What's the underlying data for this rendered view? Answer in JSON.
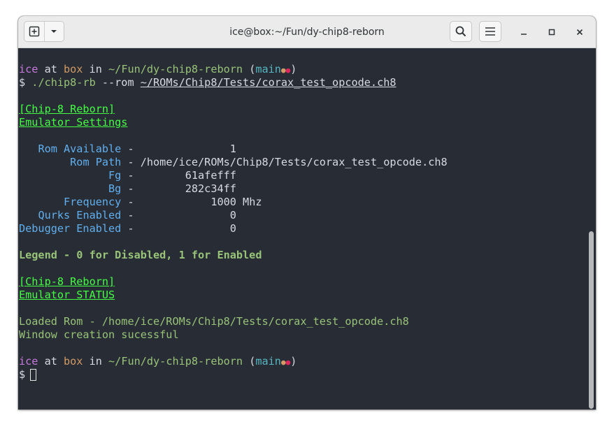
{
  "window": {
    "title": "ice@box:~/Fun/dy-chip8-reborn",
    "minimize_glyph": "–",
    "maximize_glyph": "□",
    "close_glyph": "×",
    "icons": [
      "new-tab-icon",
      "dropdown-icon",
      "search-icon",
      "hamburger-menu-icon",
      "minimize-icon",
      "maximize-icon",
      "close-icon"
    ]
  },
  "prompt": {
    "user": "ice",
    "at": " at ",
    "host": "box",
    "in": " in ",
    "path": "~/Fun/dy-chip8-reborn",
    "open_paren": " (",
    "branch": "main",
    "dot1": "●",
    "dot2": "●",
    "close_paren": ")",
    "dollar": "$ "
  },
  "command": {
    "program": "./chip8-rb",
    "flag": " --rom ",
    "arg": "~/ROMs/Chip8/Tests/corax_test_opcode.ch8"
  },
  "output": {
    "header1": "[Chip-8 Reborn]",
    "header1_sub": "Emulator Settings",
    "settings": [
      {
        "pad": "   ",
        "label": "Rom Available",
        "sep": " - ",
        "value": "              1"
      },
      {
        "pad": "        ",
        "label": "Rom Path",
        "sep": " - ",
        "value": "/home/ice/ROMs/Chip8/Tests/corax_test_opcode.ch8"
      },
      {
        "pad": "              ",
        "label": "Fg",
        "sep": " - ",
        "value": "       61afefff"
      },
      {
        "pad": "              ",
        "label": "Bg",
        "sep": " - ",
        "value": "       282c34ff"
      },
      {
        "pad": "       ",
        "label": "Frequency",
        "sep": " - ",
        "value": "           1000 Mhz"
      },
      {
        "pad": "   ",
        "label": "Qurks Enabled",
        "sep": " - ",
        "value": "              0"
      },
      {
        "pad": "",
        "label": "Debugger Enabled",
        "sep": " - ",
        "value": "              0"
      }
    ],
    "legend": "Legend - 0 for Disabled, 1 for Enabled",
    "header2": "[Chip-8 Reborn]",
    "header2_sub": "Emulator STATUS",
    "status1": "Loaded Rom - /home/ice/ROMs/Chip8/Tests/corax_test_opcode.ch8",
    "status2": "Window creation sucessful"
  }
}
